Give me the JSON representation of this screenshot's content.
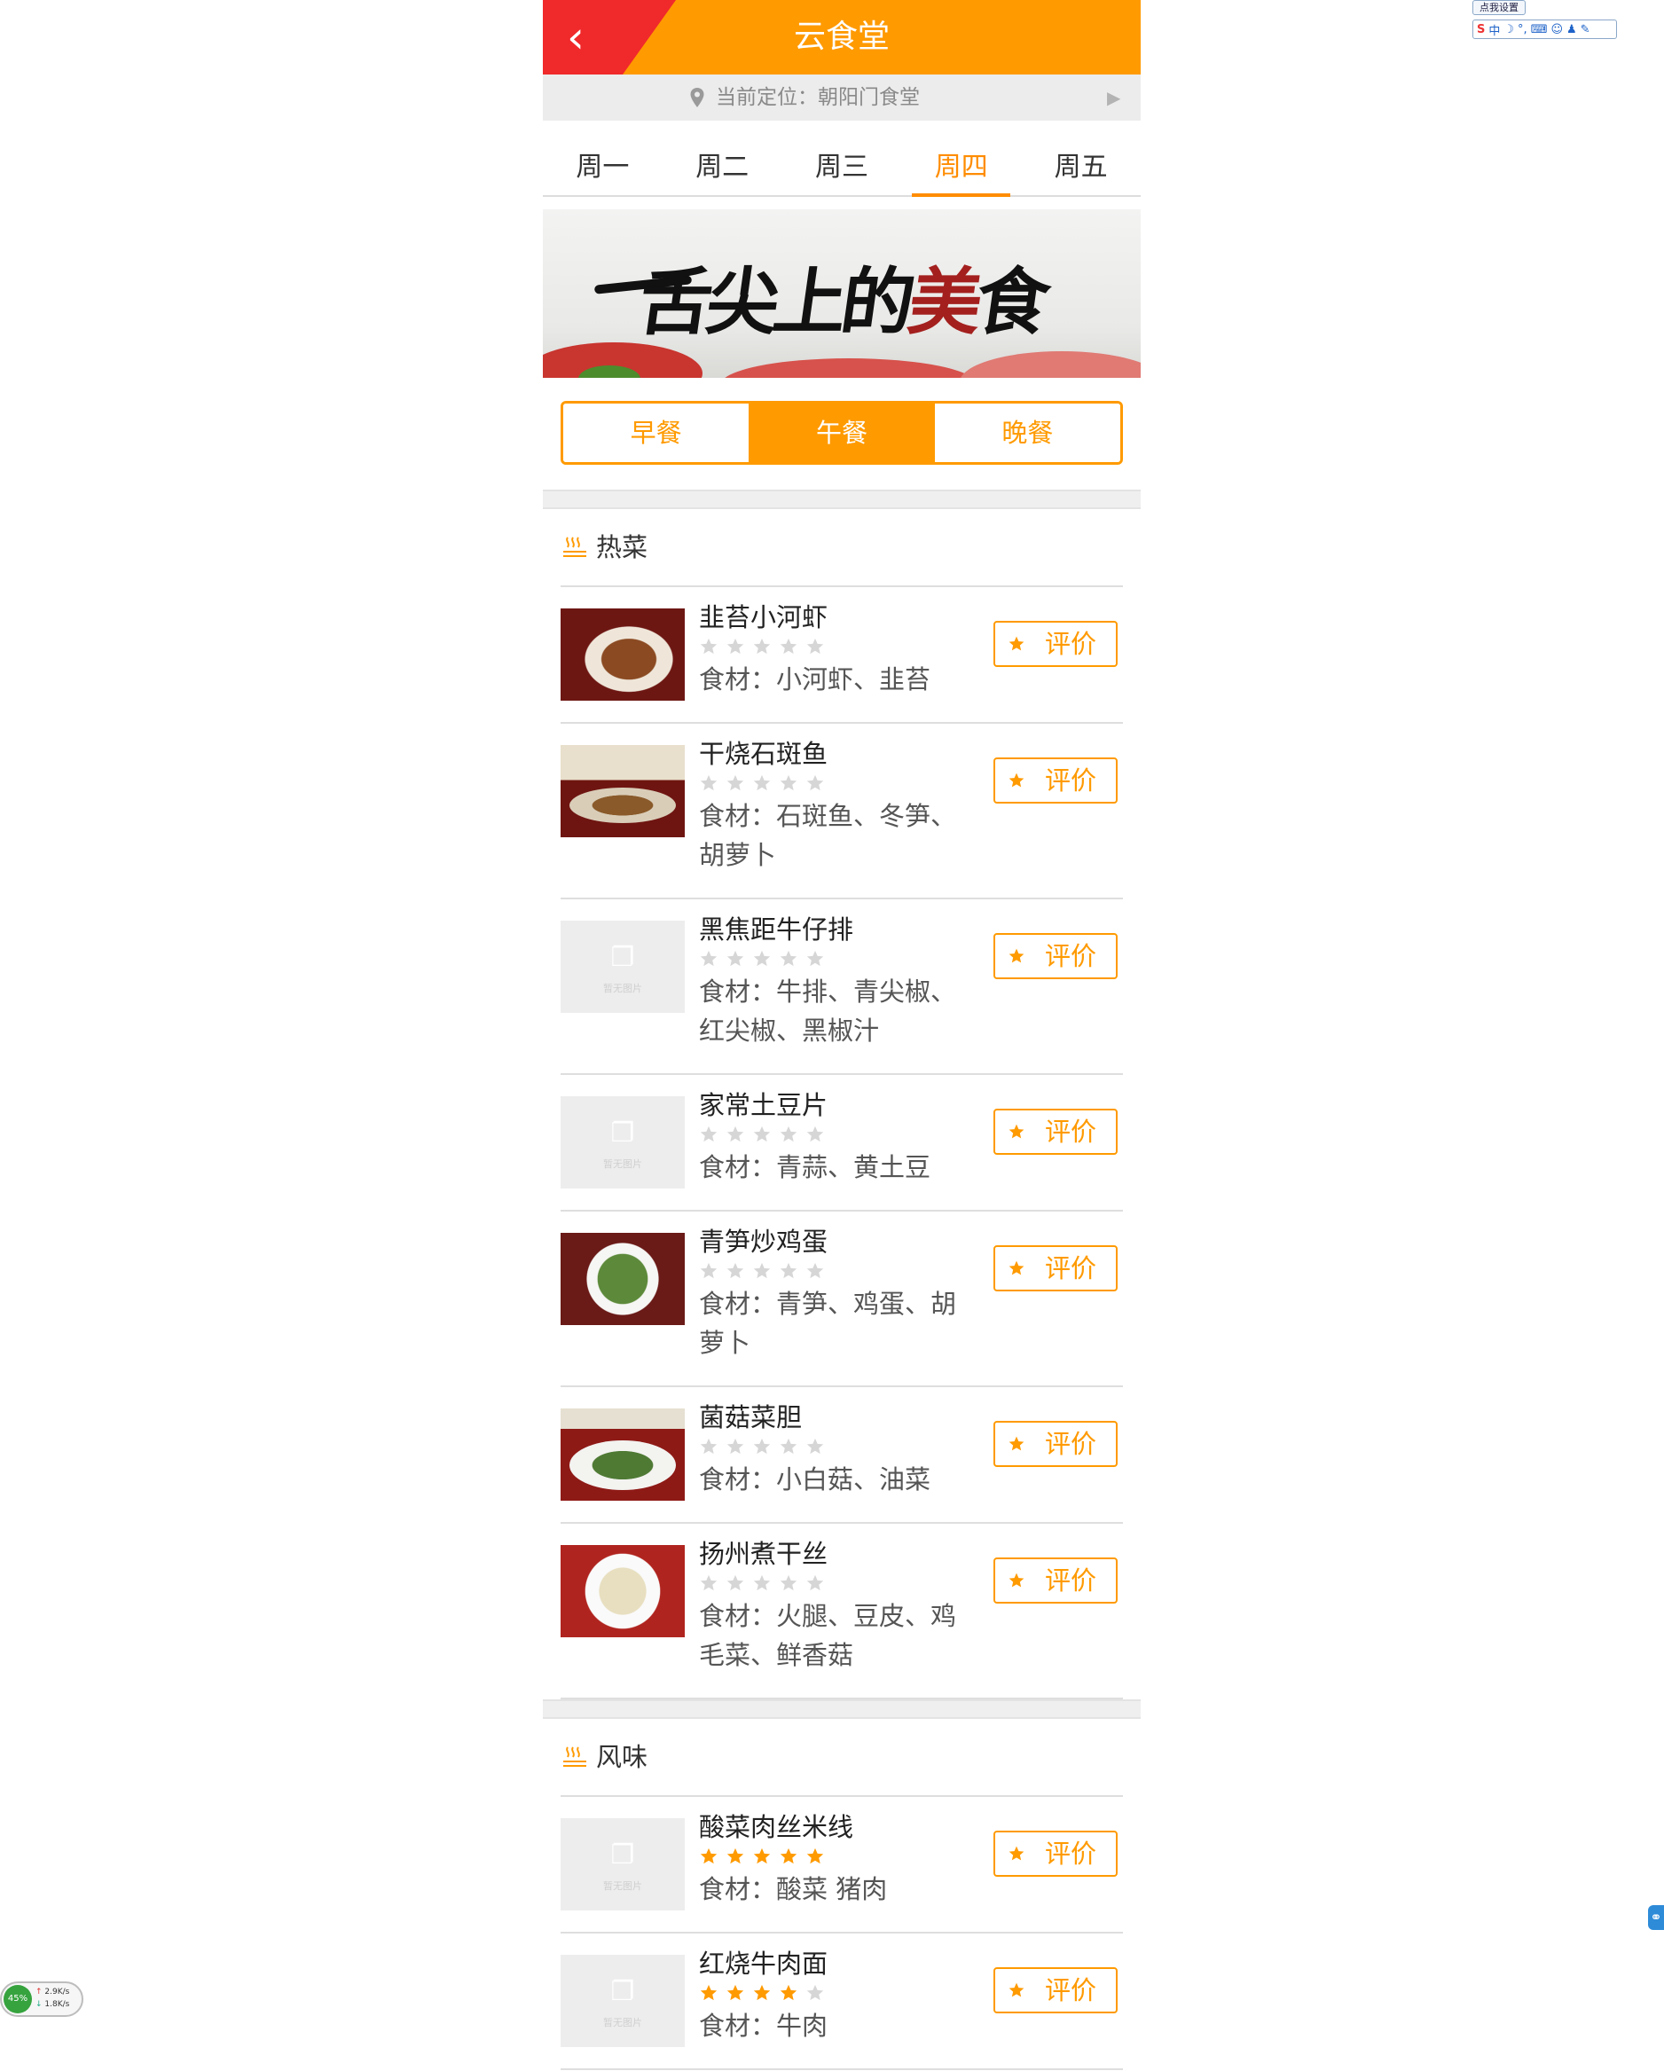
{
  "header": {
    "title": "云食堂",
    "back_icon": "back-chevron-icon",
    "colors": {
      "accent": "#ff9a00",
      "corner": "#f0292b"
    }
  },
  "location": {
    "text": "当前定位：朝阳门食堂"
  },
  "days": [
    "周一",
    "周二",
    "周三",
    "周四",
    "周五"
  ],
  "active_day": "周四",
  "meals": [
    "早餐",
    "午餐",
    "晚餐"
  ],
  "active_meal": "午餐",
  "categories": [
    {
      "name": "热菜",
      "dishes": [
        {
          "name": "韭苔小河虾",
          "ingredients": "食材：小河虾、韭苔",
          "rating": 0,
          "image": "photo"
        },
        {
          "name": "干烧石斑鱼",
          "ingredients": "食材：石斑鱼、冬笋、胡萝卜",
          "rating": 0,
          "image": "photo"
        },
        {
          "name": "黑焦距牛仔排",
          "ingredients": "食材：牛排、青尖椒、红尖椒、黑椒汁",
          "rating": 0,
          "image": "none"
        },
        {
          "name": "家常土豆片",
          "ingredients": "食材：青蒜、黄土豆",
          "rating": 0,
          "image": "none"
        },
        {
          "name": "青笋炒鸡蛋",
          "ingredients": "食材：青笋、鸡蛋、胡萝卜",
          "rating": 0,
          "image": "photo"
        },
        {
          "name": "菌菇菜胆",
          "ingredients": "食材：小白菇、油菜",
          "rating": 0,
          "image": "photo"
        },
        {
          "name": "扬州煮干丝",
          "ingredients": "食材：火腿、豆皮、鸡毛菜、鲜香菇",
          "rating": 0,
          "image": "photo"
        }
      ]
    },
    {
      "name": "风味",
      "dishes": [
        {
          "name": "酸菜肉丝米线",
          "ingredients": "食材：酸菜 猪肉",
          "rating": 5,
          "image": "none"
        },
        {
          "name": "红烧牛肉面",
          "ingredients": "食材：牛肉",
          "rating": 4,
          "image": "none"
        }
      ]
    }
  ],
  "rate_label": "评价",
  "no_image_text": "暂无图片",
  "ime": {
    "settings_label": "点我设置",
    "mode": "中"
  },
  "network": {
    "percent": "45%",
    "up": "2.9K/s",
    "down": "1.8K/s"
  }
}
